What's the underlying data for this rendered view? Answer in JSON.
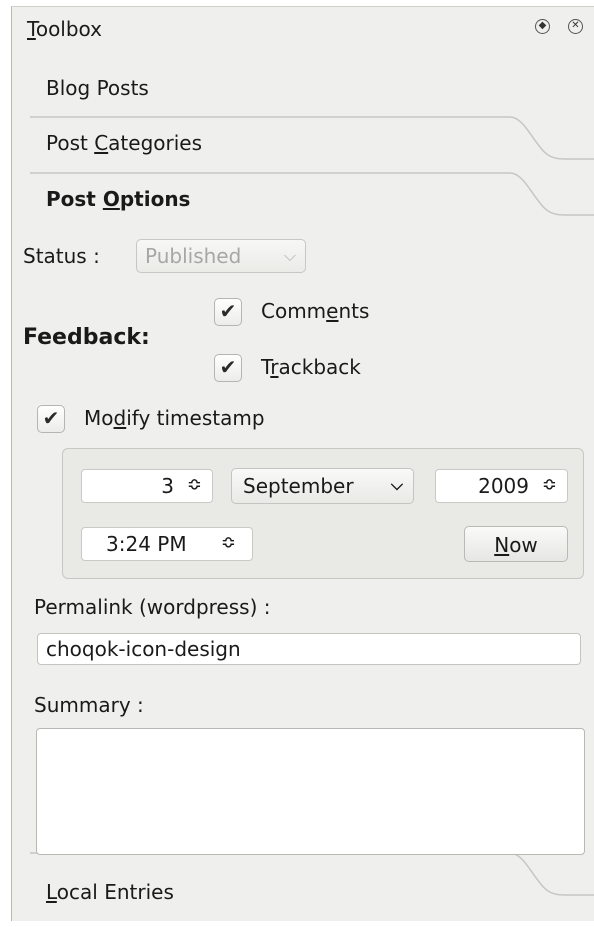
{
  "toolbox": {
    "title_underlined": "T",
    "title_rest": "oolbox"
  },
  "sections": {
    "blog_posts": "Blog Posts",
    "post_categories_pre": "Post ",
    "post_categories_ul": "C",
    "post_categories_post": "ategories",
    "post_options_pre": "Post ",
    "post_options_ul": "O",
    "post_options_post": "ptions",
    "local_entries_ul": "L",
    "local_entries_post": "ocal Entries"
  },
  "status": {
    "label": "Status :",
    "value": "Published"
  },
  "feedback": {
    "label": "Feedback:",
    "comments_pre": "Comm",
    "comments_ul": "e",
    "comments_post": "nts",
    "comments_checked": true,
    "trackback_pre": "T",
    "trackback_ul": "r",
    "trackback_post": "ackback",
    "trackback_checked": true
  },
  "timestamp": {
    "modify_pre": "Mo",
    "modify_ul": "d",
    "modify_post": "ify timestamp",
    "modify_checked": true,
    "day": "3",
    "month": "September",
    "year": "2009",
    "time": "3:24 PM",
    "now_ul": "N",
    "now_post": "ow"
  },
  "permalink": {
    "label": "Permalink (wordpress) :",
    "value": "choqok-icon-design"
  },
  "summary": {
    "label": "Summary :",
    "value": ""
  },
  "icons": {
    "check": "✔",
    "float": "◈",
    "close": "✕",
    "spin": "⬍",
    "chevron": "⌄"
  }
}
